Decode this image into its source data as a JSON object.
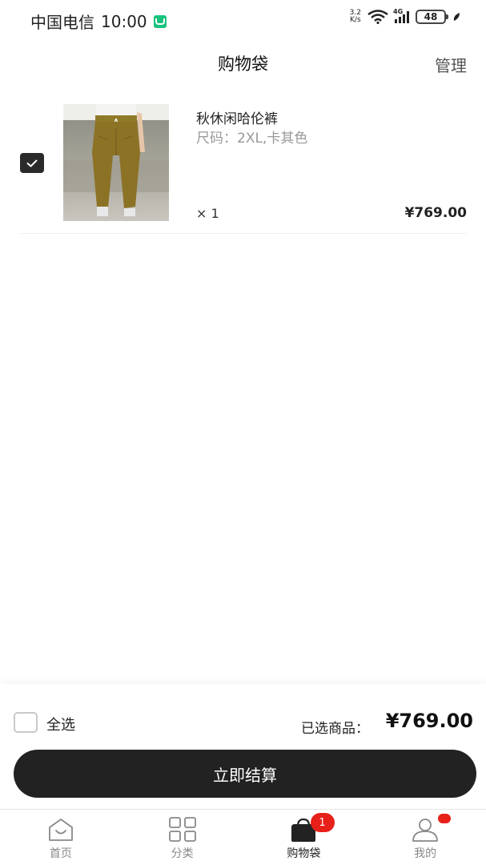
{
  "status_bar": {
    "carrier": "中国电信",
    "time": "10:00",
    "net_speed_top": "3.2",
    "net_speed_bottom": "K/s",
    "network": "4G",
    "battery": "48"
  },
  "header": {
    "title": "购物袋",
    "manage_label": "管理"
  },
  "cart": {
    "items": [
      {
        "name": "秋休闲哈伦裤",
        "spec": "尺码：2XL,卡其色",
        "quantity": "× 1",
        "price": "¥769.00",
        "checked": true,
        "image": "khaki-harem-pants"
      }
    ]
  },
  "summary": {
    "select_all_label": "全选",
    "selected_label": "已选商品：",
    "total_price": "¥769.00",
    "checkout_label": "立即结算"
  },
  "tabs": [
    {
      "label": "首页",
      "icon": "home-icon",
      "active": false
    },
    {
      "label": "分类",
      "icon": "grid-icon",
      "active": false
    },
    {
      "label": "购物袋",
      "icon": "bag-icon",
      "active": true,
      "badge": "1"
    },
    {
      "label": "我的",
      "icon": "user-icon",
      "active": false
    }
  ],
  "colors": {
    "primary": "#222222",
    "badge": "#e8201a",
    "muted_text": "#999999"
  }
}
